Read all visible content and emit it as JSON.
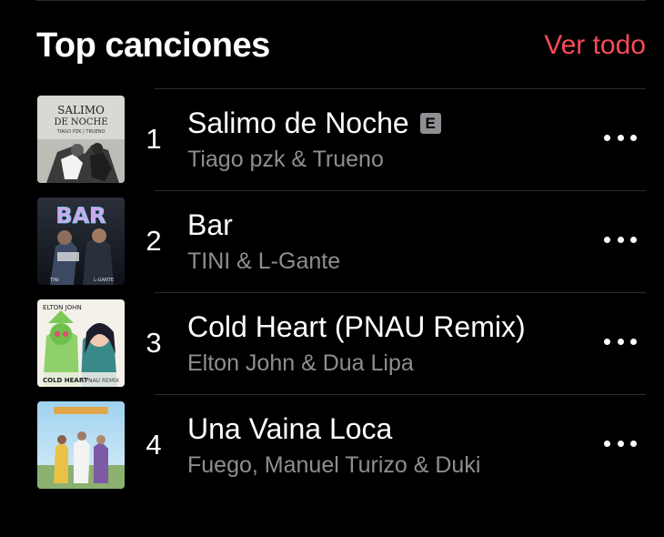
{
  "header": {
    "title": "Top canciones",
    "see_all": "Ver todo"
  },
  "songs": [
    {
      "rank": "1",
      "title": "Salimo de Noche",
      "explicit": "E",
      "artist": "Tiago pzk & Trueno",
      "artwork_text": [
        "SALIMO",
        "DE NOCHE",
        "TIAGO PZK | TRUENO"
      ]
    },
    {
      "rank": "2",
      "title": "Bar",
      "artist": "TINI & L-Gante",
      "artwork_text": [
        "BAR",
        "TINI",
        "L-GANTE"
      ]
    },
    {
      "rank": "3",
      "title": "Cold Heart (PNAU Remix)",
      "artist": "Elton John & Dua Lipa",
      "artwork_text": [
        "ELTON JOHN",
        "COLD HEART",
        "PNAU REMIX"
      ]
    },
    {
      "rank": "4",
      "title": "Una Vaina Loca",
      "artist": "Fuego, Manuel Turizo & Duki"
    }
  ],
  "colors": {
    "accent": "#fa4b57",
    "secondary_text": "#8e8e93",
    "background": "#000000"
  },
  "icons": {
    "explicit": "explicit-badge",
    "more": "ellipsis-icon"
  }
}
